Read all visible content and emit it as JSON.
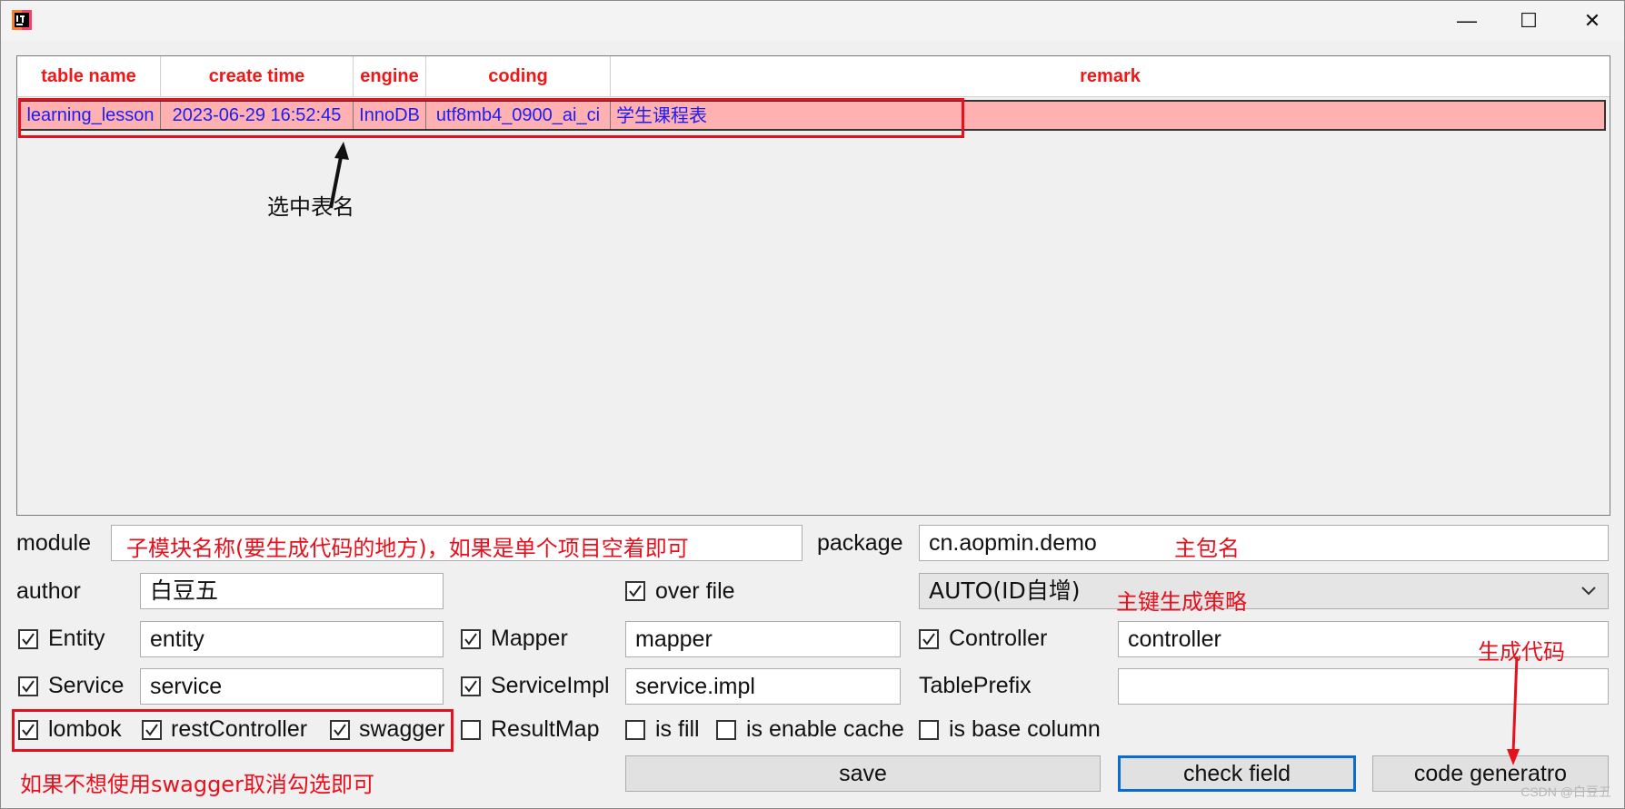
{
  "window": {
    "minimize": "—",
    "maximize": "☐",
    "close": "✕"
  },
  "table": {
    "headers": [
      "table name",
      "create time",
      "engine",
      "coding",
      "remark"
    ],
    "row": [
      "learning_lesson",
      "2023-06-29 16:52:45",
      "InnoDB",
      "utf8mb4_0900_ai_ci",
      "学生课程表"
    ]
  },
  "annotations": {
    "select_table": "选中表名",
    "module_hint": "子模块名称(要生成代码的地方)，如果是单个项目空着即可",
    "package_hint": "主包名",
    "strategy_hint": "主键生成策略",
    "generate_hint": "生成代码",
    "swagger_hint": "如果不想使用swagger取消勾选即可"
  },
  "form": {
    "module_label": "module",
    "module_value": "",
    "package_label": "package",
    "package_value": "cn.aopmin.demo",
    "author_label": "author",
    "author_value": "白豆五",
    "over_file_label": "over file",
    "id_strategy": "AUTO(ID自增)",
    "entity_label": "Entity",
    "entity_value": "entity",
    "mapper_label": "Mapper",
    "mapper_value": "mapper",
    "controller_label": "Controller",
    "controller_value": "controller",
    "service_label": "Service",
    "service_value": "service",
    "serviceimpl_label": "ServiceImpl",
    "serviceimpl_value": "service.impl",
    "tableprefix_label": "TablePrefix",
    "tableprefix_value": "",
    "lombok_label": "lombok",
    "restcontroller_label": "restController",
    "swagger_label": "swagger",
    "resultmap_label": "ResultMap",
    "isfill_label": "is fill",
    "enablecache_label": "is enable cache",
    "basecolumn_label": "is base column"
  },
  "checks": {
    "over_file": true,
    "entity": true,
    "mapper": true,
    "controller": true,
    "service": true,
    "serviceimpl": true,
    "lombok": true,
    "restcontroller": true,
    "swagger": true,
    "resultmap": false,
    "isfill": false,
    "enablecache": false,
    "basecolumn": false
  },
  "buttons": {
    "save": "save",
    "check": "check field",
    "generate": "code generatro"
  },
  "watermark": "CSDN @白豆五"
}
